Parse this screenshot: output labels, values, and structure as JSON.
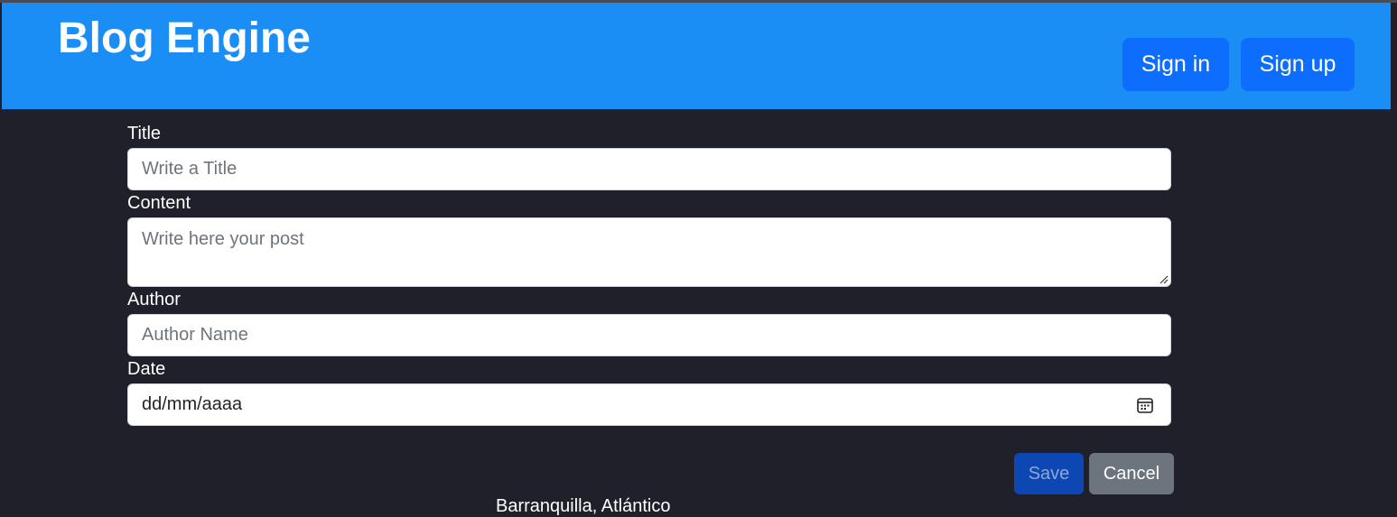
{
  "header": {
    "brand": "Blog Engine",
    "sign_in_label": "Sign in",
    "sign_up_label": "Sign up"
  },
  "form": {
    "title_label": "Title",
    "title_placeholder": "Write a Title",
    "content_label": "Content",
    "content_placeholder": "Write here your post",
    "author_label": "Author",
    "author_placeholder": "Author Name",
    "date_label": "Date",
    "date_placeholder": "dd/mm/aaaa",
    "save_label": "Save",
    "cancel_label": "Cancel"
  },
  "footer": {
    "location": "Barranquilla, Atlántico"
  },
  "colors": {
    "header_bg": "#1b8ef5",
    "primary_button": "#0d6efd",
    "page_bg": "#1f202a",
    "cancel_bg": "#6c757d"
  },
  "icons": {
    "date_picker": "calendar-icon",
    "textarea_resize": "resize-grip-icon"
  }
}
